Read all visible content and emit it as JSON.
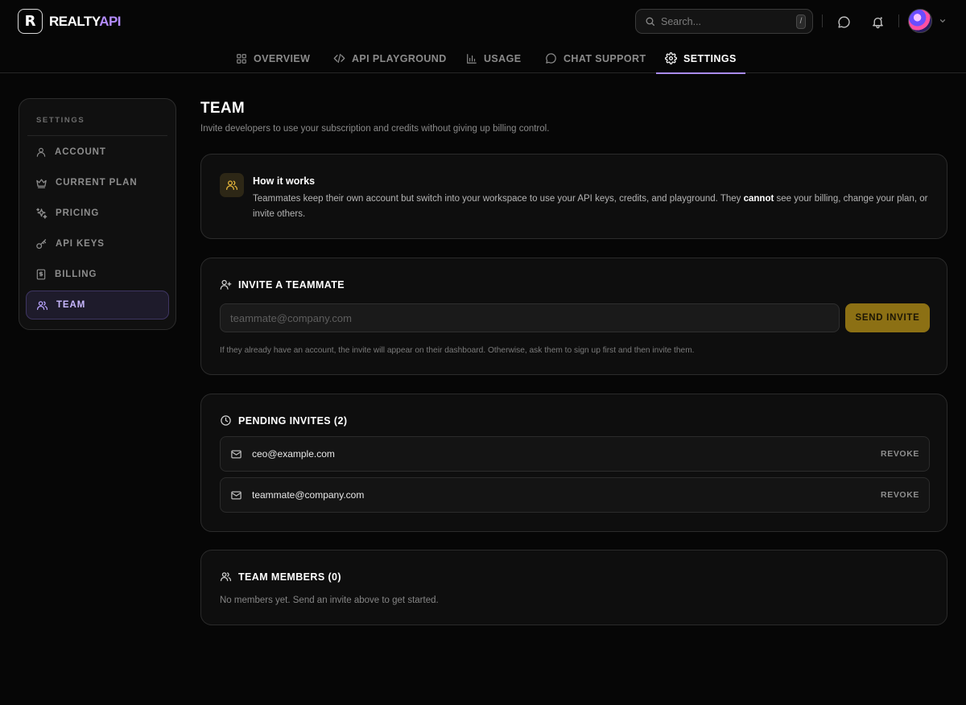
{
  "brand": {
    "name_main": "REALTY",
    "name_accent": "API",
    "mark_letter": "R"
  },
  "search": {
    "placeholder": "Search...",
    "shortcut": "/"
  },
  "tabs": [
    {
      "label": "OVERVIEW",
      "icon": "grid-icon"
    },
    {
      "label": "API PLAYGROUND",
      "icon": "code-icon"
    },
    {
      "label": "USAGE",
      "icon": "bar-chart-icon"
    },
    {
      "label": "CHAT SUPPORT",
      "icon": "chat-icon"
    },
    {
      "label": "SETTINGS",
      "icon": "gear-icon",
      "active": true
    }
  ],
  "sidebar": {
    "title": "SETTINGS",
    "items": [
      {
        "label": "ACCOUNT",
        "icon": "user-icon"
      },
      {
        "label": "CURRENT PLAN",
        "icon": "crown-icon"
      },
      {
        "label": "PRICING",
        "icon": "sparkles-icon"
      },
      {
        "label": "API KEYS",
        "icon": "key-icon"
      },
      {
        "label": "BILLING",
        "icon": "receipt-icon"
      },
      {
        "label": "TEAM",
        "icon": "users-icon",
        "active": true
      }
    ]
  },
  "page": {
    "title": "TEAM",
    "subtitle": "Invite developers to use your subscription and credits without giving up billing control."
  },
  "how_it_works": {
    "title": "How it works",
    "body_before": "Teammates keep their own account but switch into your workspace to use your API keys, credits, and playground. They ",
    "body_bold": "cannot",
    "body_after": " see your billing, change your plan, or invite others."
  },
  "invite": {
    "heading": "INVITE A TEAMMATE",
    "email_placeholder": "teammate@company.com",
    "email_value": "",
    "button_label": "SEND INVITE",
    "help_text": "If they already have an account, the invite will appear on their dashboard. Otherwise, ask them to sign up first and then invite them."
  },
  "pending": {
    "heading": "PENDING INVITES (2)",
    "items": [
      {
        "email": "ceo@example.com",
        "action": "REVOKE"
      },
      {
        "email": "teammate@company.com",
        "action": "REVOKE"
      }
    ]
  },
  "members": {
    "heading": "TEAM MEMBERS (0)",
    "empty_text": "No members yet. Send an invite above to get started."
  },
  "colors": {
    "accent_purple": "#a98cf0",
    "accent_gold": "#8c7014",
    "background": "#060606"
  }
}
